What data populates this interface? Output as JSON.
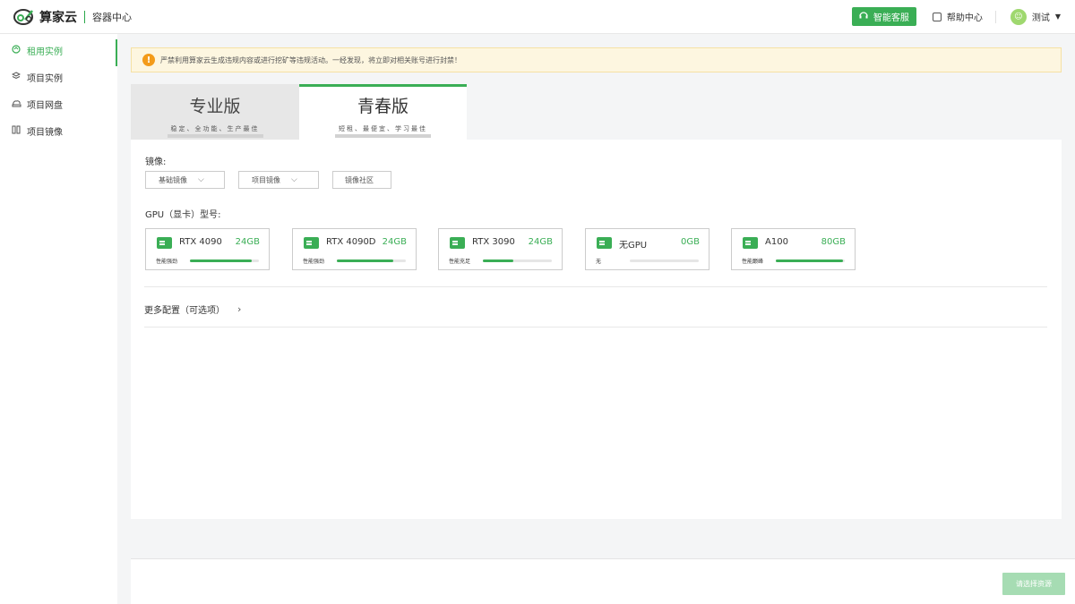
{
  "header": {
    "brand": "算家云",
    "subtitle": "容器中心",
    "service_label": "智能客服",
    "help_label": "帮助中心",
    "user_name": "测试"
  },
  "sidebar": {
    "items": [
      {
        "label": "租用实例",
        "icon": "rent-icon",
        "active": true
      },
      {
        "label": "项目实例",
        "icon": "layers-icon",
        "active": false
      },
      {
        "label": "项目网盘",
        "icon": "cloud-disk-icon",
        "active": false
      },
      {
        "label": "项目镜像",
        "icon": "grid-icon",
        "active": false
      }
    ]
  },
  "notice": {
    "text": "严禁利用算家云生成违规内容或进行挖矿等违规活动。一经发现，将立即对相关账号进行封禁！"
  },
  "tabs": [
    {
      "title": "专业版",
      "subtitle": "稳定、全功能、生产最佳",
      "active": false
    },
    {
      "title": "青春版",
      "subtitle": "短租、最便宜、学习最佳",
      "active": true
    }
  ],
  "image_section": {
    "label": "镜像:",
    "options": [
      "基础镜像",
      "项目镜像",
      "镜像社区"
    ]
  },
  "gpu_section": {
    "label": "GPU（显卡）型号:",
    "cards": [
      {
        "name": "RTX 4090",
        "memory": "24GB",
        "perf_label": "性能强劲",
        "perf_level": 0.9
      },
      {
        "name": "RTX 4090D",
        "memory": "24GB",
        "perf_label": "性能强劲",
        "perf_level": 0.82
      },
      {
        "name": "RTX 3090",
        "memory": "24GB",
        "perf_label": "性能充足",
        "perf_level": 0.44
      },
      {
        "name": "无GPU",
        "memory": "0GB",
        "perf_label": "无",
        "perf_level": 0.0
      },
      {
        "name": "A100",
        "memory": "80GB",
        "perf_label": "性能巅峰",
        "perf_level": 0.98
      }
    ]
  },
  "more_config": {
    "label": "更多配置（可选项）"
  },
  "footer": {
    "submit_label": "请选择资源"
  },
  "colors": {
    "accent": "#3aae55",
    "warning": "#f39b1a",
    "notice_bg": "#fdf6e0"
  }
}
